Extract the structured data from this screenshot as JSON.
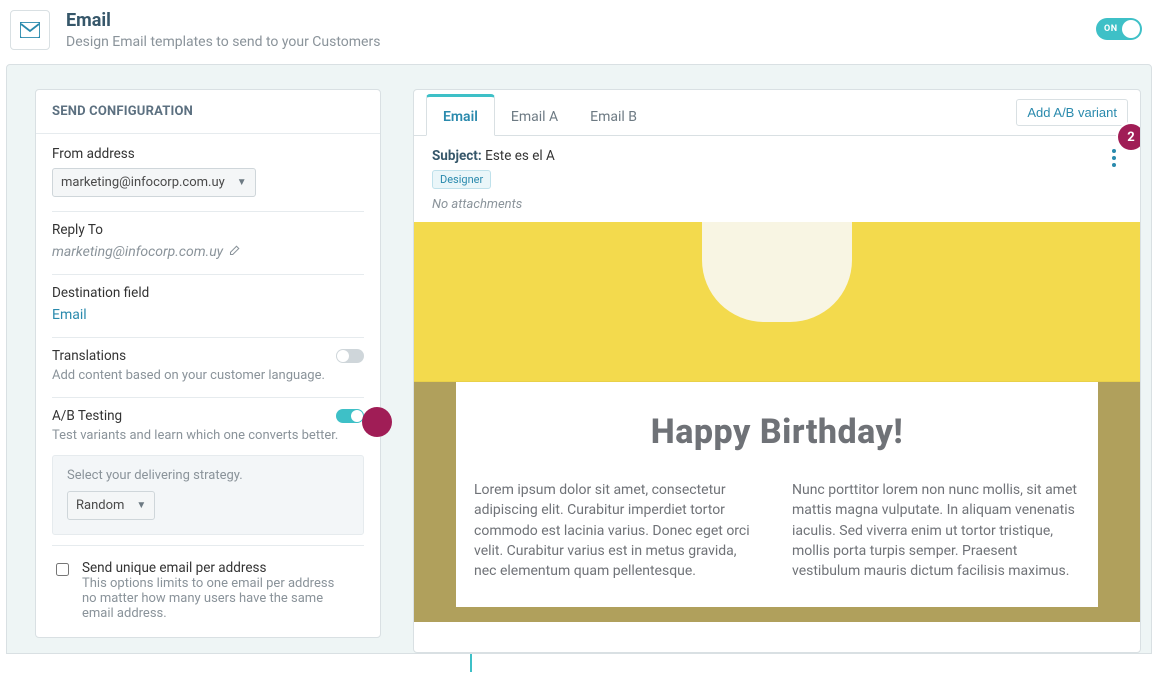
{
  "header": {
    "title": "Email",
    "subtitle": "Design Email templates to send to your Customers",
    "toggle_label": "ON"
  },
  "config": {
    "panel_title": "SEND CONFIGURATION",
    "from_label": "From address",
    "from_value": "marketing@infocorp.com.uy",
    "reply_label": "Reply To",
    "reply_value": "marketing@infocorp.com.uy",
    "dest_label": "Destination field",
    "dest_value": "Email",
    "translations_label": "Translations",
    "translations_help": "Add content based on your customer language.",
    "ab_label": "A/B Testing",
    "ab_help": "Test variants and learn which one converts better.",
    "strategy_label": "Select your delivering strategy.",
    "strategy_value": "Random",
    "unique_label": "Send unique email per address",
    "unique_help": "This options limits to one email per address no matter how many users have the same email address."
  },
  "preview": {
    "tabs": [
      "Email",
      "Email A",
      "Email B"
    ],
    "add_variant": "Add A/B variant",
    "badge": "2",
    "subject_label": "Subject:",
    "subject_value": "Este es el A",
    "designer_tag": "Designer",
    "attachments": "No attachments",
    "email_title": "Happy Birthday!",
    "col1": "Lorem ipsum dolor sit amet, consectetur adipiscing elit. Curabitur imperdiet tortor commodo est lacinia varius. Donec eget orci velit. Curabitur varius est in metus gravida, nec elementum quam pellentesque.",
    "col2": "Nunc porttitor lorem non nunc mollis, sit amet mattis magna vulputate. In aliquam venenatis iaculis. Sed viverra enim ut tortor tristique, mollis porta turpis semper. Praesent vestibulum mauris dictum facilisis maximus."
  }
}
